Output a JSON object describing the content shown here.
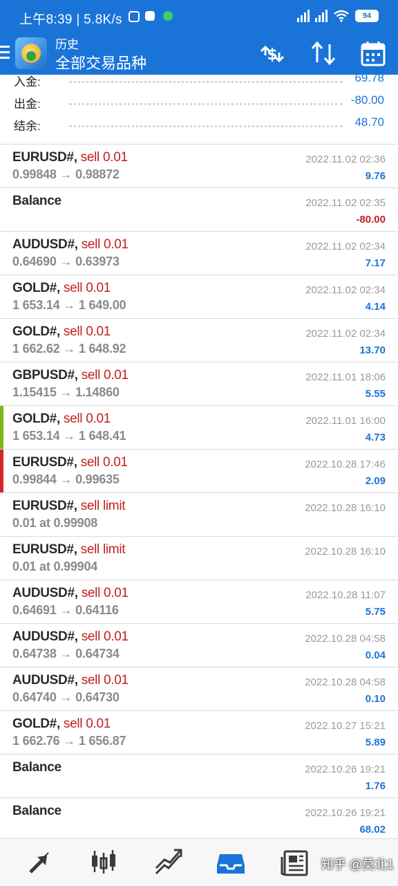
{
  "status": {
    "time": "上午8:39 | 5.8K/s",
    "battery": "94"
  },
  "header": {
    "title": "历史",
    "subtitle": "全部交易品种"
  },
  "summary": [
    {
      "label": "入金:",
      "value": "69.78"
    },
    {
      "label": "出金:",
      "value": "-80.00"
    },
    {
      "label": "结余:",
      "value": "48.70"
    }
  ],
  "deals": [
    {
      "symbol": "EURUSD#,",
      "action": "sell 0.01",
      "detail": "0.99848 → 0.98872",
      "time": "2022.11.02 02:36",
      "profit": "9.76"
    },
    {
      "symbol": "Balance",
      "action": "",
      "detail": "",
      "time": "2022.11.02 02:35",
      "profit": "-80.00"
    },
    {
      "symbol": "AUDUSD#,",
      "action": "sell 0.01",
      "detail": "0.64690 → 0.63973",
      "time": "2022.11.02 02:34",
      "profit": "7.17"
    },
    {
      "symbol": "GOLD#,",
      "action": "sell 0.01",
      "detail": "1 653.14 → 1 649.00",
      "time": "2022.11.02 02:34",
      "profit": "4.14"
    },
    {
      "symbol": "GOLD#,",
      "action": "sell 0.01",
      "detail": "1 662.62 → 1 648.92",
      "time": "2022.11.02 02:34",
      "profit": "13.70"
    },
    {
      "symbol": "GBPUSD#,",
      "action": "sell 0.01",
      "detail": "1.15415 → 1.14860",
      "time": "2022.11.01 18:06",
      "profit": "5.55"
    },
    {
      "symbol": "GOLD#,",
      "action": "sell 0.01",
      "detail": "1 653.14 → 1 648.41",
      "time": "2022.11.01 16:00",
      "profit": "4.73",
      "marker": "#7cb518"
    },
    {
      "symbol": "EURUSD#,",
      "action": "sell 0.01",
      "detail": "0.99844 → 0.99635",
      "time": "2022.10.28 17:46",
      "profit": "2.09",
      "marker": "#d42828"
    },
    {
      "symbol": "EURUSD#,",
      "action": "sell limit",
      "detail": "0.01 at 0.99908",
      "time": "2022.10.28 16:10",
      "profit": ""
    },
    {
      "symbol": "EURUSD#,",
      "action": "sell limit",
      "detail": "0.01 at 0.99904",
      "time": "2022.10.28 16:10",
      "profit": ""
    },
    {
      "symbol": "AUDUSD#,",
      "action": "sell 0.01",
      "detail": "0.64691 → 0.64116",
      "time": "2022.10.28 11:07",
      "profit": "5.75"
    },
    {
      "symbol": "AUDUSD#,",
      "action": "sell 0.01",
      "detail": "0.64738 → 0.64734",
      "time": "2022.10.28 04:58",
      "profit": "0.04"
    },
    {
      "symbol": "AUDUSD#,",
      "action": "sell 0.01",
      "detail": "0.64740 → 0.64730",
      "time": "2022.10.28 04:58",
      "profit": "0.10"
    },
    {
      "symbol": "GOLD#,",
      "action": "sell 0.01",
      "detail": "1 662.76 → 1 656.87",
      "time": "2022.10.27 15:21",
      "profit": "5.89"
    },
    {
      "symbol": "Balance",
      "action": "",
      "detail": "",
      "time": "2022.10.26 19:21",
      "profit": "1.76"
    },
    {
      "symbol": "Balance",
      "action": "",
      "detail": "",
      "time": "2022.10.26 19:21",
      "profit": "68.02"
    }
  ],
  "tabs": [
    {
      "icon": "trade-arrows-icon"
    },
    {
      "icon": "candlestick-chart-icon"
    },
    {
      "icon": "trend-line-icon"
    },
    {
      "icon": "history-inbox-icon",
      "active": true
    },
    {
      "icon": "news-icon"
    }
  ],
  "watermark": "知乎 @莫北1",
  "colors": {
    "header": "#1a74d8",
    "sell": "#c41e1e",
    "profit": "#1a74d8",
    "loss": "#c41e1e"
  }
}
